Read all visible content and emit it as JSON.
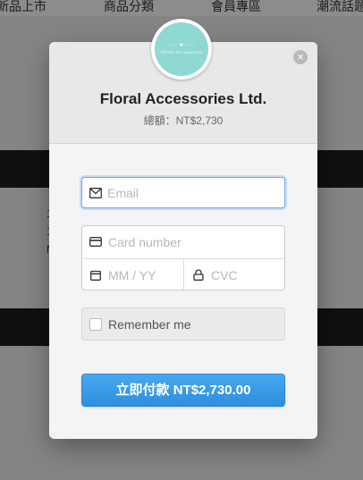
{
  "background": {
    "nav": [
      "新品上市",
      "商品分類",
      "會員專區",
      "潮流話題"
    ],
    "snippet": [
      "1",
      "1",
      "N"
    ]
  },
  "modal": {
    "logo": {
      "mark": "—— ♥ ——",
      "text": "Floral Accessories"
    },
    "merchant": "Floral Accessories Ltd.",
    "amount_line": "總額：NT$2,730",
    "close_icon": "×",
    "email": {
      "placeholder": "Email",
      "value": ""
    },
    "card_number": {
      "placeholder": "Card number",
      "value": ""
    },
    "expiry": {
      "placeholder": "MM / YY",
      "value": ""
    },
    "cvc": {
      "placeholder": "CVC",
      "value": ""
    },
    "remember_label": "Remember me",
    "pay_button": "立即付款 NT$2,730.00"
  },
  "colors": {
    "accent": "#2c8fe0",
    "logo_bg": "#8fd9d2",
    "focus_border": "#7aa8ec"
  }
}
